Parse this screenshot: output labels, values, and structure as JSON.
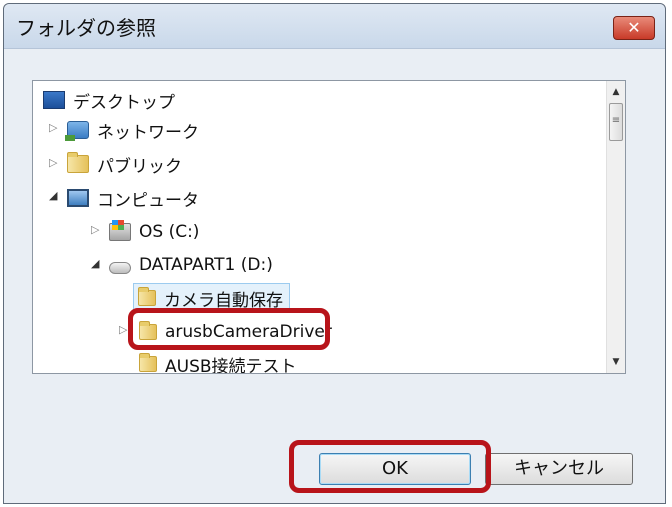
{
  "dialog": {
    "title": "フォルダの参照",
    "close_label": "✕"
  },
  "tree": {
    "items": [
      {
        "label": "デスクトップ",
        "icon": "desktop-icon"
      },
      {
        "label": "ネットワーク",
        "icon": "network-icon"
      },
      {
        "label": "パブリック",
        "icon": "folder-icon"
      },
      {
        "label": "コンピュータ",
        "icon": "computer-icon"
      },
      {
        "label": "OS (C:)",
        "icon": "drive-os-icon"
      },
      {
        "label": "DATAPART1 (D:)",
        "icon": "drive-icon"
      },
      {
        "label": "カメラ自動保存",
        "icon": "folder-icon",
        "selected": true
      },
      {
        "label": "arusbCameraDriver",
        "icon": "folder-icon"
      },
      {
        "label": "AUSB接続テスト",
        "icon": "folder-icon"
      }
    ]
  },
  "scrollbar": {
    "up": "▲",
    "down": "▼",
    "thumb": "≡"
  },
  "buttons": {
    "ok": "OK",
    "cancel": "キャンセル"
  },
  "colors": {
    "highlight": "#b8141a",
    "selection": "#e4f1fb"
  }
}
